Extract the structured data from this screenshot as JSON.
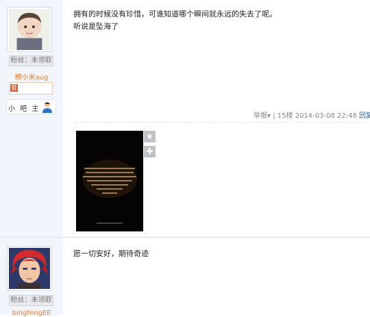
{
  "post1": {
    "user": {
      "name": "穆小米aug",
      "fans_button": "粉丝：未领取",
      "badge_icon": "赞",
      "rank_label": "小 吧 主"
    },
    "lines": [
      "拥有的时候没有珍惜，可谁知道哪个瞬间就永远的失去了呢。",
      "听说是坠海了"
    ],
    "footer": {
      "report": "举报",
      "report_arrow": "▾",
      "sep": "|",
      "floor": "15楼",
      "datetime": "2014-03-08 22:48",
      "reply": "回复"
    },
    "image_buttons": {
      "star": "★",
      "plus": "✚"
    }
  },
  "post2": {
    "user": {
      "name": "bingfengEE",
      "fans_button": "粉丝：未领取"
    },
    "lines": [
      "愿一切安好，期待奇迹"
    ]
  },
  "colors": {
    "sidebar_bg": "#f1f5fc",
    "username": "#f07b2c",
    "link": "#2d64b3"
  }
}
